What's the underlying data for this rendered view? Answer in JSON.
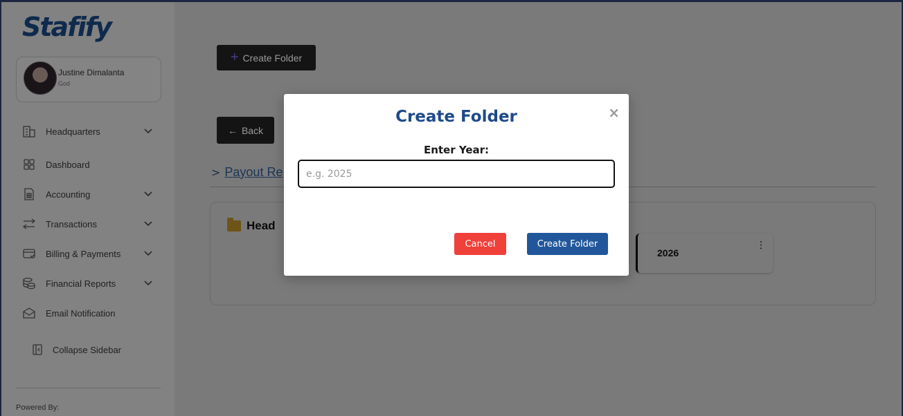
{
  "sidebar": {
    "logo": "Stafify",
    "profile": {
      "name": "Justine Dimalanta",
      "role": "God"
    },
    "items": [
      {
        "label": "Headquarters",
        "icon": "building-icon",
        "has_chevron": true
      },
      {
        "label": "Dashboard",
        "icon": "grid-icon",
        "has_chevron": false
      },
      {
        "label": "Accounting",
        "icon": "calculator-icon",
        "has_chevron": true
      },
      {
        "label": "Transactions",
        "icon": "transfer-icon",
        "has_chevron": true
      },
      {
        "label": "Billing & Payments",
        "icon": "billing-icon",
        "has_chevron": true
      },
      {
        "label": "Financial Reports",
        "icon": "coins-icon",
        "has_chevron": true
      },
      {
        "label": "Email Notification",
        "icon": "envelope-icon",
        "has_chevron": false
      }
    ],
    "collapse_label": "Collapse Sidebar",
    "powered_by": "Powered By:"
  },
  "main": {
    "create_folder_label": "Create Folder",
    "back_label": "Back",
    "breadcrumb": "Payout Re",
    "folder_title": "Head",
    "year_cards": [
      {
        "label": "2026"
      }
    ]
  },
  "modal": {
    "title": "Create Folder",
    "close_symbol": "×",
    "field_label": "Enter Year:",
    "field_placeholder": "e.g. 2025",
    "field_value": "",
    "cancel_label": "Cancel",
    "create_label": "Create Folder"
  },
  "colors": {
    "modal_title": "#1f4a8a",
    "cancel_button": "#f0403a",
    "create_button": "#21579a"
  }
}
